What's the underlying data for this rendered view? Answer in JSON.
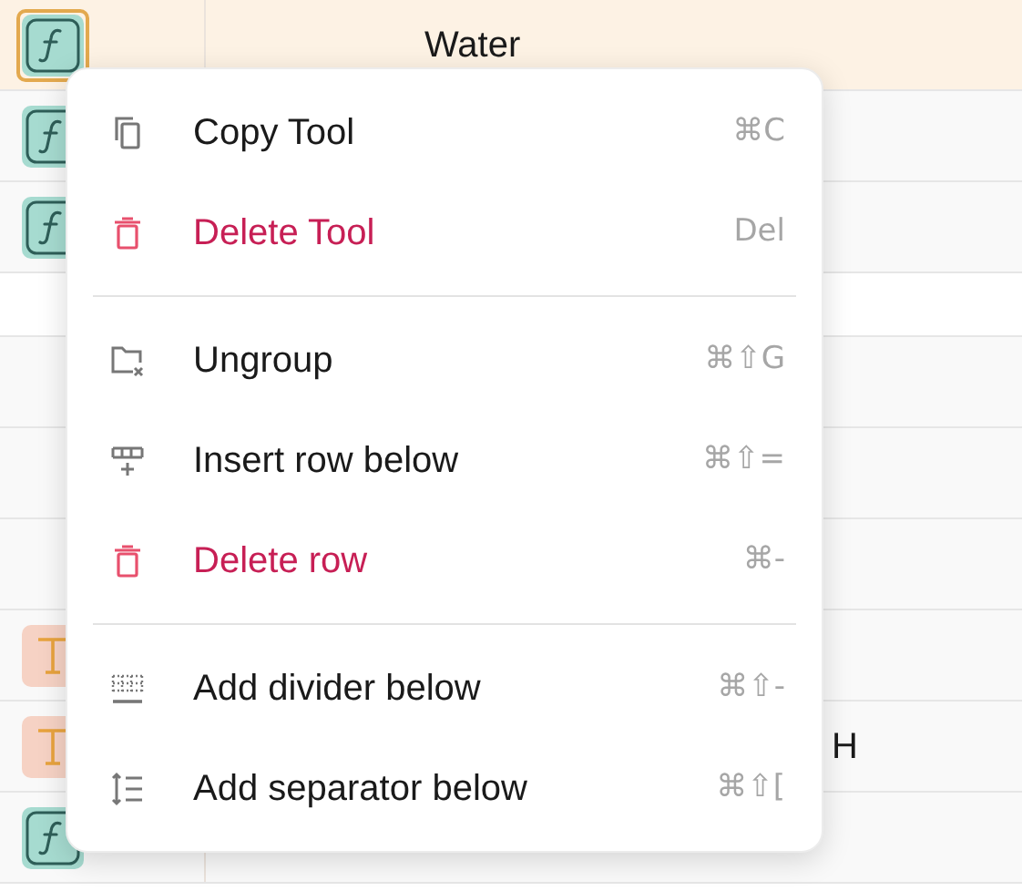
{
  "rows": [
    {
      "kind": "function",
      "selected": true,
      "text": "Water"
    },
    {
      "kind": "function",
      "selected": false
    },
    {
      "kind": "function",
      "selected": false
    },
    {
      "kind": "spacer",
      "selected": false
    },
    {
      "kind": "blank",
      "selected": false
    },
    {
      "kind": "blank",
      "selected": false
    },
    {
      "kind": "blank",
      "selected": false
    },
    {
      "kind": "text",
      "selected": false
    },
    {
      "kind": "text",
      "selected": false,
      "tail": "H"
    },
    {
      "kind": "function",
      "selected": false
    }
  ],
  "menu": [
    {
      "kind": "item",
      "label": "Copy Tool",
      "shortcut": "⌘C",
      "danger": false
    },
    {
      "kind": "item",
      "label": "Delete Tool",
      "shortcut": "Del",
      "danger": true
    },
    {
      "kind": "divider"
    },
    {
      "kind": "item",
      "label": "Ungroup",
      "shortcut": "⌘⇧G",
      "danger": false
    },
    {
      "kind": "item",
      "label": "Insert row below",
      "shortcut": "⌘⇧=",
      "danger": false
    },
    {
      "kind": "item",
      "label": "Delete row",
      "shortcut": "⌘-",
      "danger": true
    },
    {
      "kind": "divider"
    },
    {
      "kind": "item",
      "label": "Add divider below",
      "shortcut": "⌘⇧-",
      "danger": false
    },
    {
      "kind": "item",
      "label": "Add separator below",
      "shortcut": "⌘⇧[",
      "danger": false
    }
  ]
}
